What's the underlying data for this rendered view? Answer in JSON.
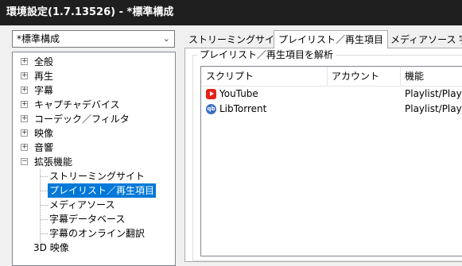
{
  "window": {
    "title": "環境設定(1.7.13526) - *標準構成"
  },
  "profile_combo": {
    "value": "*標準構成"
  },
  "tree": {
    "items": [
      {
        "label": "全般",
        "expander": "+"
      },
      {
        "label": "再生",
        "expander": "+"
      },
      {
        "label": "字幕",
        "expander": "+"
      },
      {
        "label": "キャプチャデバイス",
        "expander": "+"
      },
      {
        "label": "コーデック／フィルタ",
        "expander": "+"
      },
      {
        "label": "映像",
        "expander": "+"
      },
      {
        "label": "音響",
        "expander": "+"
      },
      {
        "label": "拡張機能",
        "expander": "−"
      }
    ],
    "children": [
      {
        "label": "ストリーミングサイト"
      },
      {
        "label": "プレイリスト／再生項目",
        "selected": true
      },
      {
        "label": "メディアソース"
      },
      {
        "label": "字幕データベース"
      },
      {
        "label": "字幕のオンライン翻訳"
      }
    ],
    "last": {
      "label": "3D 映像"
    }
  },
  "tabs": [
    {
      "label": "ストリーミングサイト"
    },
    {
      "label": "プレイリスト／再生項目",
      "active": true
    },
    {
      "label": "メディアソース"
    },
    {
      "label": "字"
    }
  ],
  "group": {
    "title": "プレイリスト／再生項目を解析"
  },
  "list": {
    "columns": [
      "スクリプト",
      "アカウント",
      "機能"
    ],
    "rows": [
      {
        "name": "YouTube",
        "account": "",
        "feature": "Playlist/Playitem",
        "icon": "youtube-icon"
      },
      {
        "name": "LibTorrent",
        "account": "",
        "feature": "Playlist/Playitem",
        "icon": "libtorrent-icon"
      }
    ]
  },
  "colors": {
    "selection": "#0078d7",
    "titlebar": "#1f1f1f"
  }
}
